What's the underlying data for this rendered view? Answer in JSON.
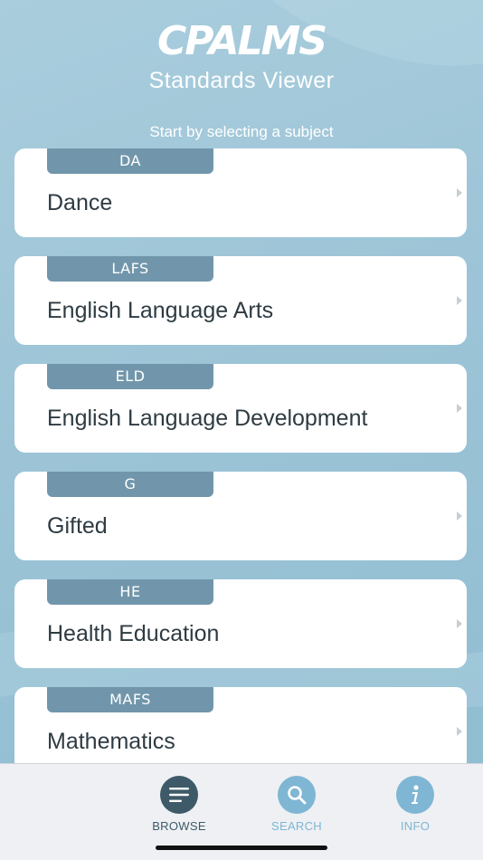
{
  "header": {
    "logo": "CPALMS",
    "title": "Standards Viewer"
  },
  "prompt": "Start by selecting a subject",
  "subjects": [
    {
      "code": "DA",
      "name": "Dance"
    },
    {
      "code": "LAFS",
      "name": "English Language Arts"
    },
    {
      "code": "ELD",
      "name": "English Language Development"
    },
    {
      "code": "G",
      "name": "Gifted"
    },
    {
      "code": "HE",
      "name": "Health Education"
    },
    {
      "code": "MAFS",
      "name": "Mathematics"
    }
  ],
  "tabbar": {
    "browse": {
      "label": "BROWSE",
      "icon": "menu-icon",
      "color": "#3e5a68"
    },
    "search": {
      "label": "SEARCH",
      "icon": "search-icon",
      "color": "#7fb6d4"
    },
    "info": {
      "label": "INFO",
      "icon": "info-icon",
      "color": "#7fb6d4"
    }
  },
  "colors": {
    "tab_bg": "#7196ab",
    "card_bg": "#ffffff",
    "accent": "#7fb6d4"
  }
}
